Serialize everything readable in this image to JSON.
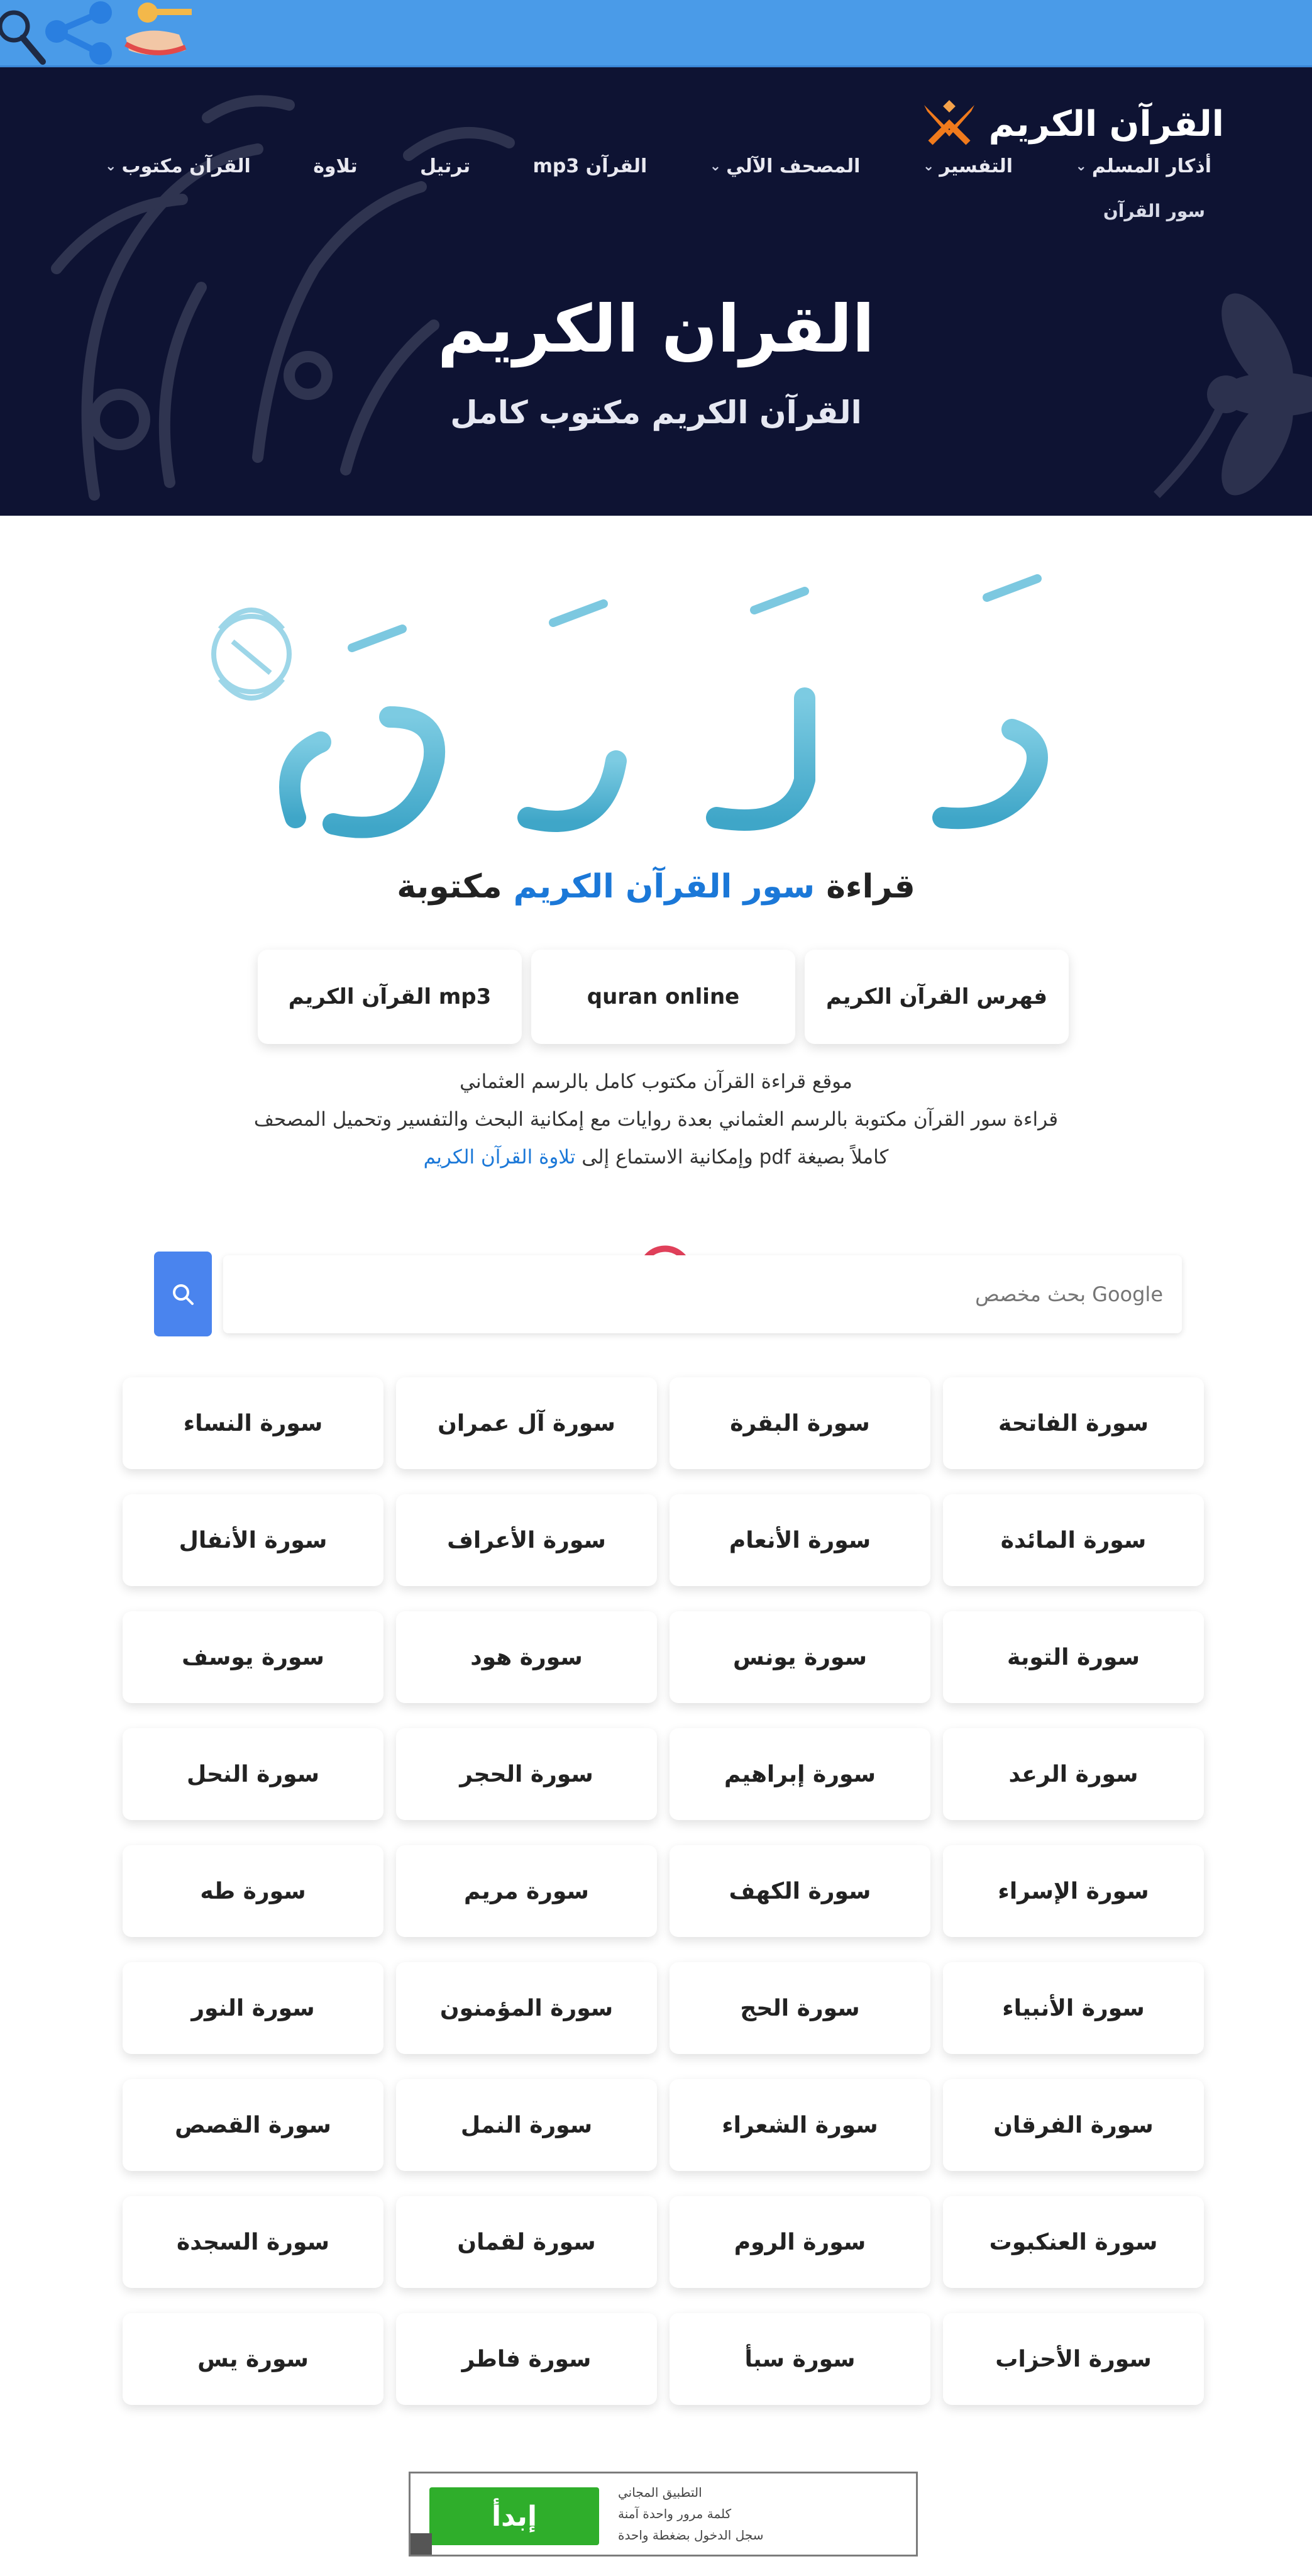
{
  "header": {
    "logo_text": "القرآن الكريم",
    "nav": [
      {
        "label": "القرآن مكتوب",
        "dropdown": true
      },
      {
        "label": "تلاوة",
        "dropdown": false
      },
      {
        "label": "ترتيل",
        "dropdown": false
      },
      {
        "label": "القرآن mp3",
        "dropdown": false
      },
      {
        "label": "المصحف الآلي",
        "dropdown": true
      },
      {
        "label": "التفسير",
        "dropdown": true
      },
      {
        "label": "أذكار المسلم",
        "dropdown": true
      }
    ],
    "nav_sub": "سور القرآن",
    "title": "القران الكريم",
    "subtitle": "القرآن الكريم مكتوب كامل"
  },
  "intro": {
    "read_prefix": "قراءة",
    "read_highlight": "سور القرآن الكريم",
    "read_suffix": "مكتوبة"
  },
  "buttons": {
    "index": "فهرس القرآن الكريم",
    "online": "quran online",
    "mp3": "القرآن الكريم mp3"
  },
  "description": {
    "line1": "موقع قراءة القرآن مكتوب كامل بالرسم العثماني",
    "line2": "قراءة سور القرآن مكتوبة بالرسم العثماني بعدة روايات مع إمكانية البحث والتفسير وتحميل المصحف",
    "line3": "كاملاً بصيغة pdf وإمكانية الاستماع إلى",
    "link": "تلاوة القرآن الكريم"
  },
  "search": {
    "placeholder": "Google بحث مخصص"
  },
  "surahs": [
    "سورة الفاتحة",
    "سورة البقرة",
    "سورة آل عمران",
    "سورة النساء",
    "سورة المائدة",
    "سورة الأنعام",
    "سورة الأعراف",
    "سورة الأنفال",
    "سورة التوبة",
    "سورة يونس",
    "سورة هود",
    "سورة يوسف",
    "سورة الرعد",
    "سورة إبراهيم",
    "سورة الحجر",
    "سورة النحل",
    "سورة الإسراء",
    "سورة الكهف",
    "سورة مريم",
    "سورة طه",
    "سورة الأنبياء",
    "سورة الحج",
    "سورة المؤمنون",
    "سورة النور",
    "سورة الفرقان",
    "سورة الشعراء",
    "سورة النمل",
    "سورة القصص",
    "سورة العنكبوت",
    "سورة الروم",
    "سورة لقمان",
    "سورة السجدة",
    "سورة الأحزاب",
    "سورة سبأ",
    "سورة فاطر",
    "سورة يس"
  ],
  "ad": {
    "button": "إبدأ",
    "line1": "التطبيق المجاني",
    "line2": "كلمة مرور واحدة آمنة",
    "line3": "سجل الدخول بضغطة واحدة"
  },
  "colors": {
    "header_bg": "#0e1333",
    "top_strip": "#4a9be8",
    "accent_blue": "#1b78d8",
    "calligraphy": "#5ab8d6",
    "ad_green": "#2fae2b"
  }
}
